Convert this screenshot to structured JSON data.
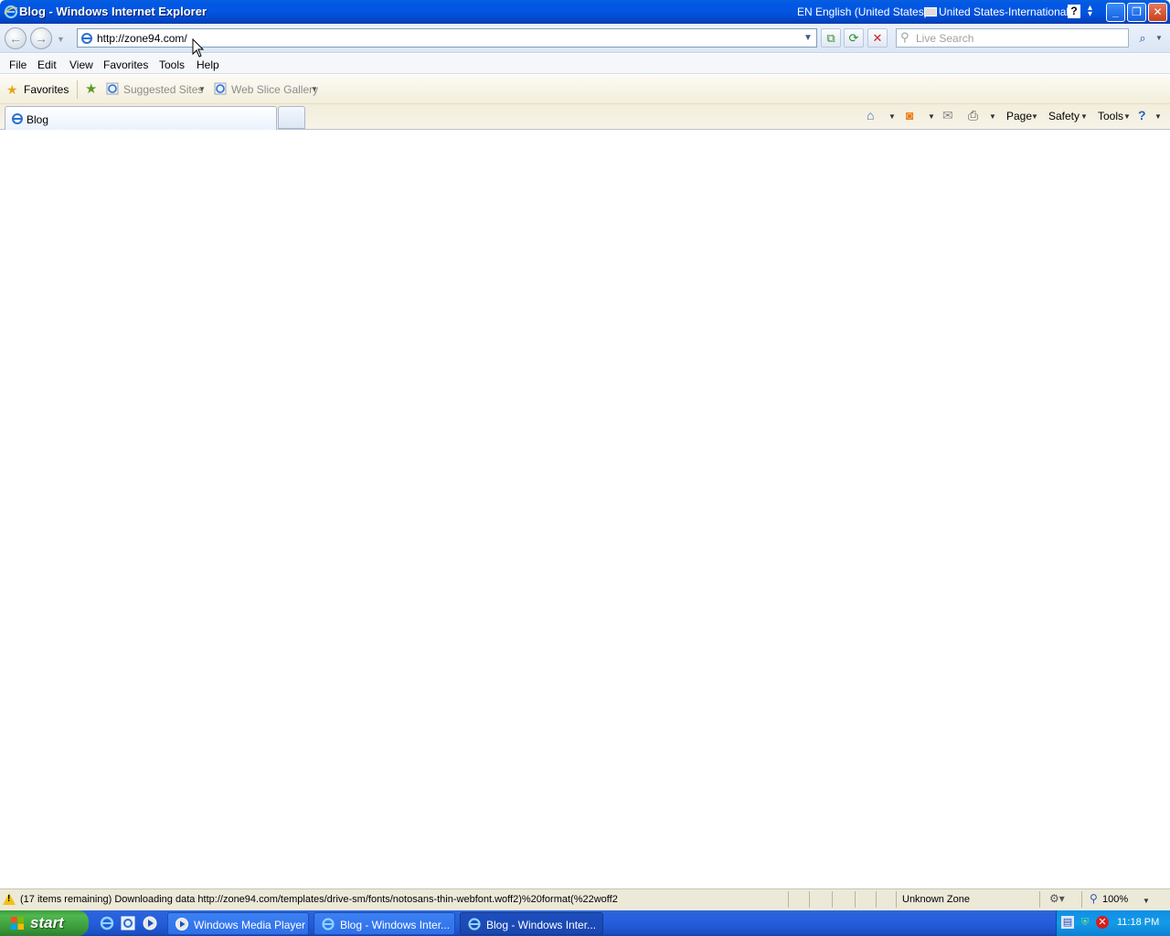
{
  "window": {
    "title": "Blog - Windows Internet Explorer",
    "language_indicator": "EN English (United States)",
    "keyboard_layout": "United States-International",
    "help_glyph": "?",
    "langbar_options_icon": "chevron-down-icon"
  },
  "nav": {
    "back_icon": "back-arrow-icon",
    "forward_icon": "forward-arrow-icon",
    "address": "http://zone94.com/",
    "search_placeholder": "Live Search"
  },
  "menu": {
    "items": [
      "File",
      "Edit",
      "View",
      "Favorites",
      "Tools",
      "Help"
    ]
  },
  "favorites_bar": {
    "favorites_label": "Favorites",
    "links": [
      "Suggested Sites",
      "Web Slice Gallery"
    ]
  },
  "tabs": {
    "active_title": "Blog"
  },
  "command_bar": {
    "page": "Page",
    "safety": "Safety",
    "tools": "Tools"
  },
  "status": {
    "text": "(17 items remaining) Downloading data http://zone94.com/templates/drive-sm/fonts/notosans-thin-webfont.woff2)%20format(%22woff2",
    "zone": "Unknown Zone",
    "zoom": "100%"
  },
  "taskbar": {
    "start_label": "start",
    "tasks": [
      {
        "label": "Windows Media Player"
      },
      {
        "label": "Blog - Windows Inter..."
      },
      {
        "label": "Blog - Windows Inter..."
      }
    ],
    "clock": "11:18 PM"
  },
  "colors": {
    "titlebar": "#0355e0",
    "taskbar": "#245edb",
    "start_button": "#3a9a3a",
    "tray": "#149be6"
  }
}
